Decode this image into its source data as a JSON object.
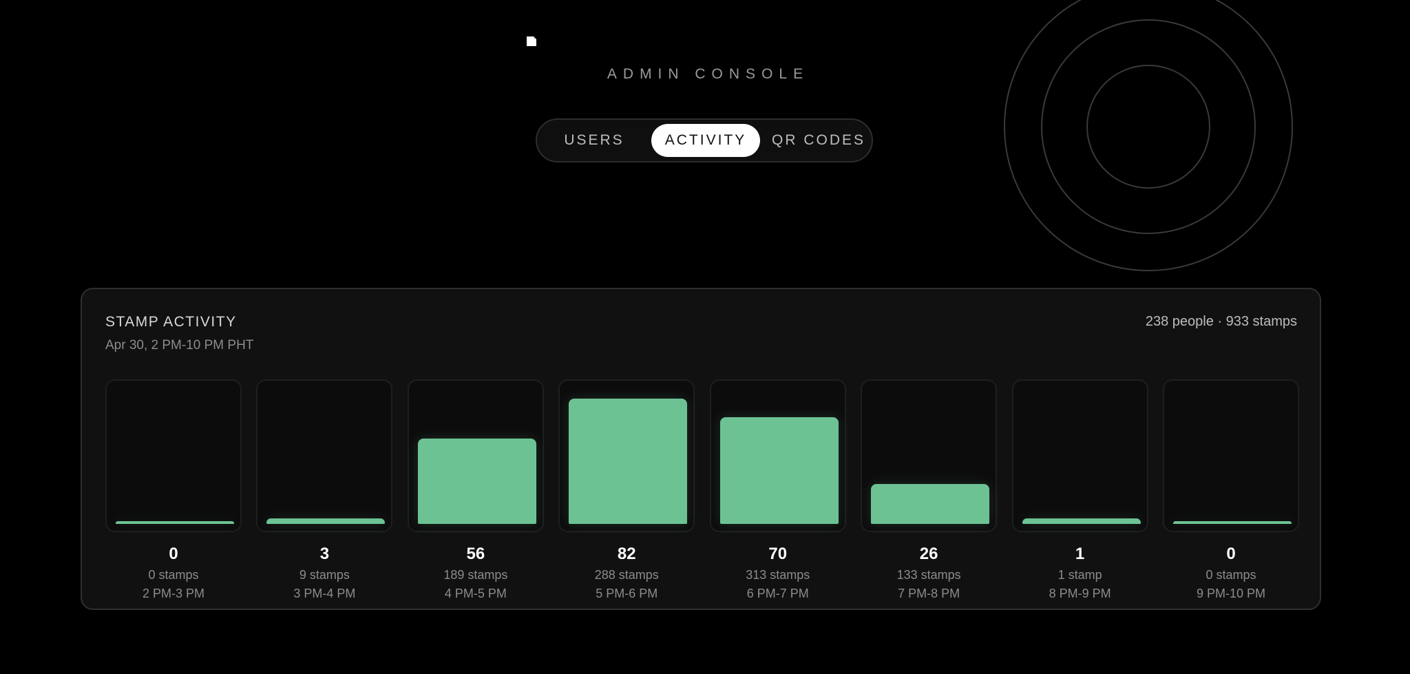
{
  "header": {
    "title": "ADMIN CONSOLE",
    "logo_icon": "broken-image-icon"
  },
  "tabs": [
    {
      "label": "USERS",
      "active": false
    },
    {
      "label": "ACTIVITY",
      "active": true
    },
    {
      "label": "QR CODES",
      "active": false
    }
  ],
  "decoration": {
    "icon": "concentric-rings-icon"
  },
  "colors": {
    "background": "#000000",
    "card": "#111111",
    "bar_fill": "#6dc294",
    "active_tab": "#ffffff"
  },
  "activity": {
    "title": "STAMP ACTIVITY",
    "subtitle": "Apr 30, 2 PM-10 PM PHT",
    "summary": "238 people · 933 stamps"
  },
  "chart_data": {
    "type": "bar",
    "title": "STAMP ACTIVITY",
    "categories": [
      "2 PM-3 PM",
      "3 PM-4 PM",
      "4 PM-5 PM",
      "5 PM-6 PM",
      "6 PM-7 PM",
      "7 PM-8 PM",
      "8 PM-9 PM",
      "9 PM-10 PM"
    ],
    "values": [
      0,
      3,
      56,
      82,
      70,
      26,
      1,
      0
    ],
    "value_labels": [
      "0",
      "3",
      "56",
      "82",
      "70",
      "26",
      "1",
      "0"
    ],
    "stamps_labels": [
      "0 stamps",
      "9 stamps",
      "189 stamps",
      "288 stamps",
      "313 stamps",
      "133 stamps",
      "1 stamp",
      "0 stamps"
    ],
    "ylim": [
      0,
      82
    ],
    "grid": false
  }
}
